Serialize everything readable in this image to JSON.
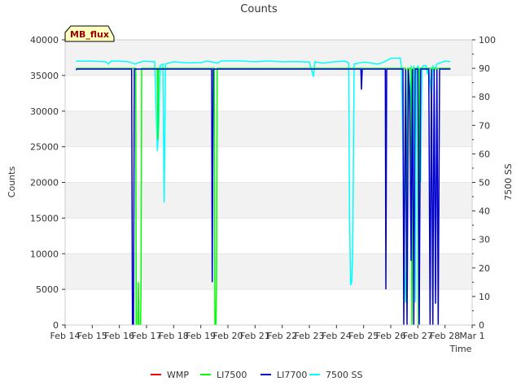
{
  "chart_data": {
    "type": "line",
    "title": "Counts",
    "xlabel": "Time",
    "ylabel": "Counts",
    "y2label": "7500 SS",
    "annotation": "MB_flux",
    "x_ticks": [
      "Feb 14",
      "Feb 15",
      "Feb 16",
      "Feb 17",
      "Feb 18",
      "Feb 19",
      "Feb 20",
      "Feb 21",
      "Feb 22",
      "Feb 23",
      "Feb 24",
      "Feb 25",
      "Feb 26",
      "Feb 27",
      "Feb 28",
      "Mar 1"
    ],
    "xlim": [
      0,
      15
    ],
    "ylim": [
      0,
      40000
    ],
    "y_ticks": [
      0,
      5000,
      10000,
      15000,
      20000,
      25000,
      30000,
      35000,
      40000
    ],
    "y2lim": [
      0,
      100
    ],
    "y2_ticks": [
      0,
      10,
      20,
      30,
      40,
      50,
      60,
      70,
      80,
      90,
      100
    ],
    "grid": true,
    "legend_position": "bottom",
    "series": [
      {
        "name": "WMP",
        "color": "#ff0000",
        "axis": "left",
        "points": []
      },
      {
        "name": "LI7500",
        "color": "#00ff00",
        "axis": "left",
        "points": [
          [
            0.4,
            36000
          ],
          [
            2.6,
            36000
          ],
          [
            2.62,
            0
          ],
          [
            2.68,
            0
          ],
          [
            2.7,
            6000
          ],
          [
            2.72,
            0
          ],
          [
            2.78,
            0
          ],
          [
            2.8,
            6000
          ],
          [
            2.82,
            36000
          ],
          [
            3.4,
            36000
          ],
          [
            3.42,
            26000
          ],
          [
            3.44,
            36000
          ],
          [
            5.5,
            36000
          ],
          [
            5.52,
            0
          ],
          [
            5.56,
            0
          ],
          [
            5.58,
            6000
          ],
          [
            5.6,
            36000
          ],
          [
            12.55,
            36000
          ],
          [
            12.58,
            3000
          ],
          [
            12.62,
            36000
          ],
          [
            12.75,
            36000
          ],
          [
            12.78,
            0
          ],
          [
            12.82,
            36000
          ],
          [
            13.0,
            36000
          ],
          [
            13.02,
            0
          ],
          [
            13.06,
            36000
          ],
          [
            13.2,
            36000
          ],
          [
            13.22,
            36000
          ],
          [
            14.2,
            36000
          ]
        ]
      },
      {
        "name": "LI7700",
        "color": "#0000cc",
        "axis": "left",
        "points": [
          [
            0.4,
            35800
          ],
          [
            0.45,
            35900
          ],
          [
            2.45,
            35900
          ],
          [
            2.48,
            0
          ],
          [
            2.52,
            0
          ],
          [
            2.55,
            35900
          ],
          [
            5.4,
            35900
          ],
          [
            5.42,
            6000
          ],
          [
            5.46,
            35900
          ],
          [
            10.9,
            35900
          ],
          [
            10.92,
            33000
          ],
          [
            10.95,
            35900
          ],
          [
            11.8,
            35900
          ],
          [
            11.82,
            5000
          ],
          [
            11.85,
            35900
          ],
          [
            12.45,
            35900
          ],
          [
            12.48,
            0
          ],
          [
            12.52,
            22000
          ],
          [
            12.55,
            35900
          ],
          [
            12.6,
            0
          ],
          [
            12.65,
            35900
          ],
          [
            12.7,
            32000
          ],
          [
            12.75,
            9000
          ],
          [
            12.8,
            35900
          ],
          [
            12.85,
            0
          ],
          [
            12.9,
            35900
          ],
          [
            13.0,
            35900
          ],
          [
            13.05,
            0
          ],
          [
            13.1,
            35900
          ],
          [
            13.4,
            35900
          ],
          [
            13.45,
            0
          ],
          [
            13.5,
            35900
          ],
          [
            13.55,
            0
          ],
          [
            13.6,
            35900
          ],
          [
            13.65,
            3000
          ],
          [
            13.7,
            35900
          ],
          [
            13.75,
            0
          ],
          [
            13.8,
            35900
          ],
          [
            14.2,
            35900
          ]
        ]
      },
      {
        "name": "7500 SS",
        "color": "#00ffff",
        "axis": "right",
        "points": [
          [
            0.4,
            92.5
          ],
          [
            1.0,
            92.5
          ],
          [
            1.5,
            92.3
          ],
          [
            1.6,
            91.5
          ],
          [
            1.7,
            92.6
          ],
          [
            2.3,
            92.4
          ],
          [
            2.5,
            91.8
          ],
          [
            2.6,
            91.5
          ],
          [
            2.7,
            92.0
          ],
          [
            2.9,
            92.5
          ],
          [
            3.3,
            92.3
          ],
          [
            3.4,
            61
          ],
          [
            3.45,
            70
          ],
          [
            3.5,
            91
          ],
          [
            3.6,
            91.5
          ],
          [
            3.65,
            43
          ],
          [
            3.7,
            91.5
          ],
          [
            4.0,
            92.3
          ],
          [
            4.5,
            91.9
          ],
          [
            5.0,
            92.0
          ],
          [
            5.2,
            92.5
          ],
          [
            5.4,
            92.3
          ],
          [
            5.6,
            91.8
          ],
          [
            5.75,
            92.6
          ],
          [
            6.5,
            92.6
          ],
          [
            7.0,
            92.3
          ],
          [
            7.5,
            92.6
          ],
          [
            8.0,
            92.3
          ],
          [
            8.5,
            92.4
          ],
          [
            9.0,
            92.2
          ],
          [
            9.1,
            89
          ],
          [
            9.15,
            87
          ],
          [
            9.2,
            92.3
          ],
          [
            9.5,
            91.8
          ],
          [
            10.0,
            92.4
          ],
          [
            10.3,
            92.5
          ],
          [
            10.45,
            92.0
          ],
          [
            10.48,
            40
          ],
          [
            10.52,
            14
          ],
          [
            10.56,
            15
          ],
          [
            10.6,
            25
          ],
          [
            10.65,
            91.5
          ],
          [
            11.0,
            92.2
          ],
          [
            11.3,
            91.8
          ],
          [
            11.5,
            91.5
          ],
          [
            11.7,
            92.0
          ],
          [
            12.0,
            93.5
          ],
          [
            12.35,
            93.6
          ],
          [
            12.4,
            90
          ],
          [
            12.45,
            60
          ],
          [
            12.5,
            20
          ],
          [
            12.55,
            8
          ],
          [
            12.6,
            40
          ],
          [
            12.65,
            89
          ],
          [
            12.7,
            75
          ],
          [
            12.75,
            91
          ],
          [
            12.8,
            30
          ],
          [
            12.85,
            91
          ],
          [
            12.9,
            8
          ],
          [
            12.95,
            89
          ],
          [
            13.0,
            91
          ],
          [
            13.05,
            89
          ],
          [
            13.1,
            50
          ],
          [
            13.15,
            90
          ],
          [
            13.2,
            91
          ],
          [
            13.3,
            91
          ],
          [
            13.35,
            88
          ],
          [
            13.4,
            90
          ],
          [
            13.5,
            80
          ],
          [
            13.55,
            91
          ],
          [
            13.6,
            89
          ],
          [
            13.7,
            91.5
          ],
          [
            14.0,
            92.5
          ],
          [
            14.2,
            92.4
          ]
        ]
      }
    ]
  }
}
